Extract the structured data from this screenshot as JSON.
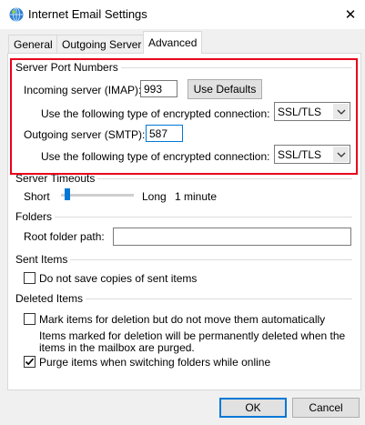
{
  "window": {
    "title": "Internet Email Settings",
    "icon": "globe-mail-icon",
    "close_glyph": "✕"
  },
  "tabs": [
    {
      "label": "General",
      "active": false
    },
    {
      "label": "Outgoing Server",
      "active": false
    },
    {
      "label": "Advanced",
      "active": true
    }
  ],
  "server_ports": {
    "group_label": "Server Port Numbers",
    "incoming_label": "Incoming server (IMAP):",
    "incoming_value": "993",
    "use_defaults_label": "Use Defaults",
    "incoming_enc_label": "Use the following type of encrypted connection:",
    "incoming_enc_value": "SSL/TLS",
    "outgoing_label": "Outgoing server (SMTP):",
    "outgoing_value": "587",
    "outgoing_enc_label": "Use the following type of encrypted connection:",
    "outgoing_enc_value": "SSL/TLS"
  },
  "timeouts": {
    "group_label": "Server Timeouts",
    "short_label": "Short",
    "long_label": "Long",
    "value_label": "1 minute",
    "slider_fraction": 0.05
  },
  "folders": {
    "group_label": "Folders",
    "root_label": "Root folder path:",
    "root_value": ""
  },
  "sent_items": {
    "group_label": "Sent Items",
    "no_copies_label": "Do not save copies of sent items",
    "no_copies_checked": false
  },
  "deleted_items": {
    "group_label": "Deleted Items",
    "mark_label": "Mark items for deletion but do not move them automatically",
    "mark_checked": false,
    "note_line1": "Items marked for deletion will be permanently deleted when the",
    "note_line2": "items in the mailbox are purged.",
    "purge_label": "Purge items when switching folders while online",
    "purge_checked": true
  },
  "footer": {
    "ok_label": "OK",
    "cancel_label": "Cancel"
  },
  "colors": {
    "highlight_border": "#e8001c",
    "focus_border": "#0078d7"
  }
}
